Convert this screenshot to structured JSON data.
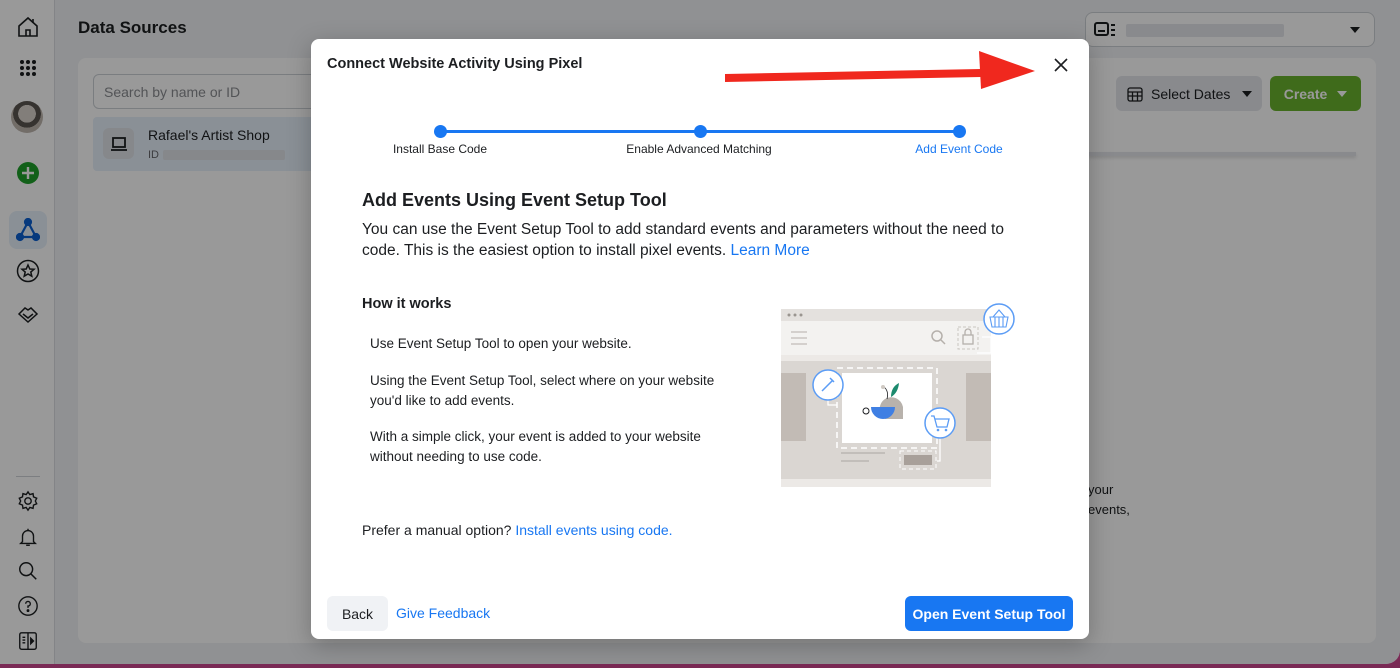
{
  "app": {
    "page_title": "Data Sources",
    "account_selector": {
      "value_redacted": true
    },
    "search": {
      "placeholder": "Search by name or ID"
    },
    "sources": [
      {
        "name": "Rafael's Artist Shop",
        "id_label": "ID"
      }
    ],
    "select_dates_label": "Select Dates",
    "create_label": "Create",
    "background_text": [
      "your",
      "events,"
    ]
  },
  "sidebar": {
    "items": [
      {
        "icon": "home-icon"
      },
      {
        "icon": "apps-grid-icon"
      },
      {
        "icon": "profile-avatar"
      },
      {
        "icon": "add-circle-icon"
      },
      {
        "icon": "events-manager-icon",
        "active": true
      },
      {
        "icon": "star-icon"
      },
      {
        "icon": "partnership-icon"
      },
      {
        "icon": "gear-icon"
      },
      {
        "icon": "bell-icon"
      },
      {
        "icon": "search-icon"
      },
      {
        "icon": "help-icon"
      },
      {
        "icon": "sidebar-toggle-icon"
      }
    ]
  },
  "modal": {
    "title": "Connect Website Activity Using Pixel",
    "steps": [
      {
        "label": "Install Base Code",
        "state": "complete"
      },
      {
        "label": "Enable Advanced Matching",
        "state": "complete"
      },
      {
        "label": "Add Event Code",
        "state": "current"
      }
    ],
    "section_title": "Add Events Using Event Setup Tool",
    "intro_text": "You can use the Event Setup Tool to add standard events and parameters without the need to code. This is the easiest option to install pixel events.",
    "learn_more": "Learn More",
    "how_title": "How it works",
    "how_steps": [
      "Use Event Setup Tool to open your website.",
      "Using the Event Setup Tool, select where on your website you'd like to add events.",
      "With a simple click, your event is added to your website without needing to use code."
    ],
    "manual_prefix": "Prefer a manual option?",
    "manual_link": "Install events using code.",
    "back_label": "Back",
    "feedback_label": "Give Feedback",
    "primary_label": "Open Event Setup Tool"
  },
  "annotation": {
    "type": "red-arrow",
    "points_to": "close-button",
    "color": "#f0281e"
  },
  "colors": {
    "accent": "#1877f2",
    "create_green": "#69b32d"
  }
}
